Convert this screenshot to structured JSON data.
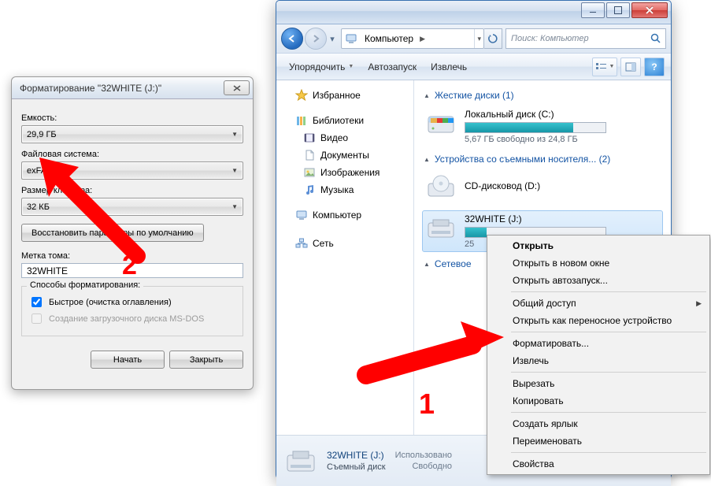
{
  "format_dialog": {
    "title": "Форматирование \"32WHITE (J:)\"",
    "capacity_label": "Емкость:",
    "capacity_value": "29,9 ГБ",
    "filesystem_label": "Файловая система:",
    "filesystem_value": "exFAT",
    "cluster_label": "Размер кластера:",
    "cluster_value": "32 КБ",
    "restore_defaults": "Восстановить параметры по умолчанию",
    "volume_label_label": "Метка тома:",
    "volume_label_value": "32WHITE",
    "options_legend": "Способы форматирования:",
    "quick_format": "Быстрое (очистка оглавления)",
    "msdos_boot": "Создание загрузочного диска MS-DOS",
    "start_button": "Начать",
    "close_button": "Закрыть"
  },
  "explorer": {
    "nav": {
      "address_root": "Компьютер",
      "search_placeholder": "Поиск: Компьютер"
    },
    "toolbar": {
      "organize": "Упорядочить",
      "autorun": "Автозапуск",
      "eject": "Извлечь"
    },
    "navpane": {
      "favorites": "Избранное",
      "libraries": "Библиотеки",
      "videos": "Видео",
      "documents": "Документы",
      "pictures": "Изображения",
      "music": "Музыка",
      "computer": "Компьютер",
      "network": "Сеть"
    },
    "content": {
      "h_hdd": "Жесткие диски (1)",
      "local_disk": "Локальный диск (C:)",
      "local_disk_free": "5,67 ГБ свободно из 24,8 ГБ",
      "local_disk_fill_pct": 77,
      "h_removable": "Устройства со съемными носителя... (2)",
      "cdrom": "CD-дисковод (D:)",
      "usb": "32WHITE (J:)",
      "usb_sub": "25",
      "h_network": "Сетевое"
    },
    "status": {
      "name": "32WHITE (J:)",
      "type": "Съемный диск",
      "used_label": "Использовано",
      "free_label": "Свободно"
    }
  },
  "context_menu": {
    "open": "Открыть",
    "open_new": "Открыть в новом окне",
    "open_autorun": "Открыть автозапуск...",
    "share": "Общий доступ",
    "open_portable": "Открыть как переносное устройство",
    "format": "Форматировать...",
    "eject": "Извлечь",
    "cut": "Вырезать",
    "copy": "Копировать",
    "shortcut": "Создать ярлык",
    "rename": "Переименовать",
    "properties": "Свойства"
  },
  "annotations": {
    "one": "1",
    "two": "2"
  }
}
